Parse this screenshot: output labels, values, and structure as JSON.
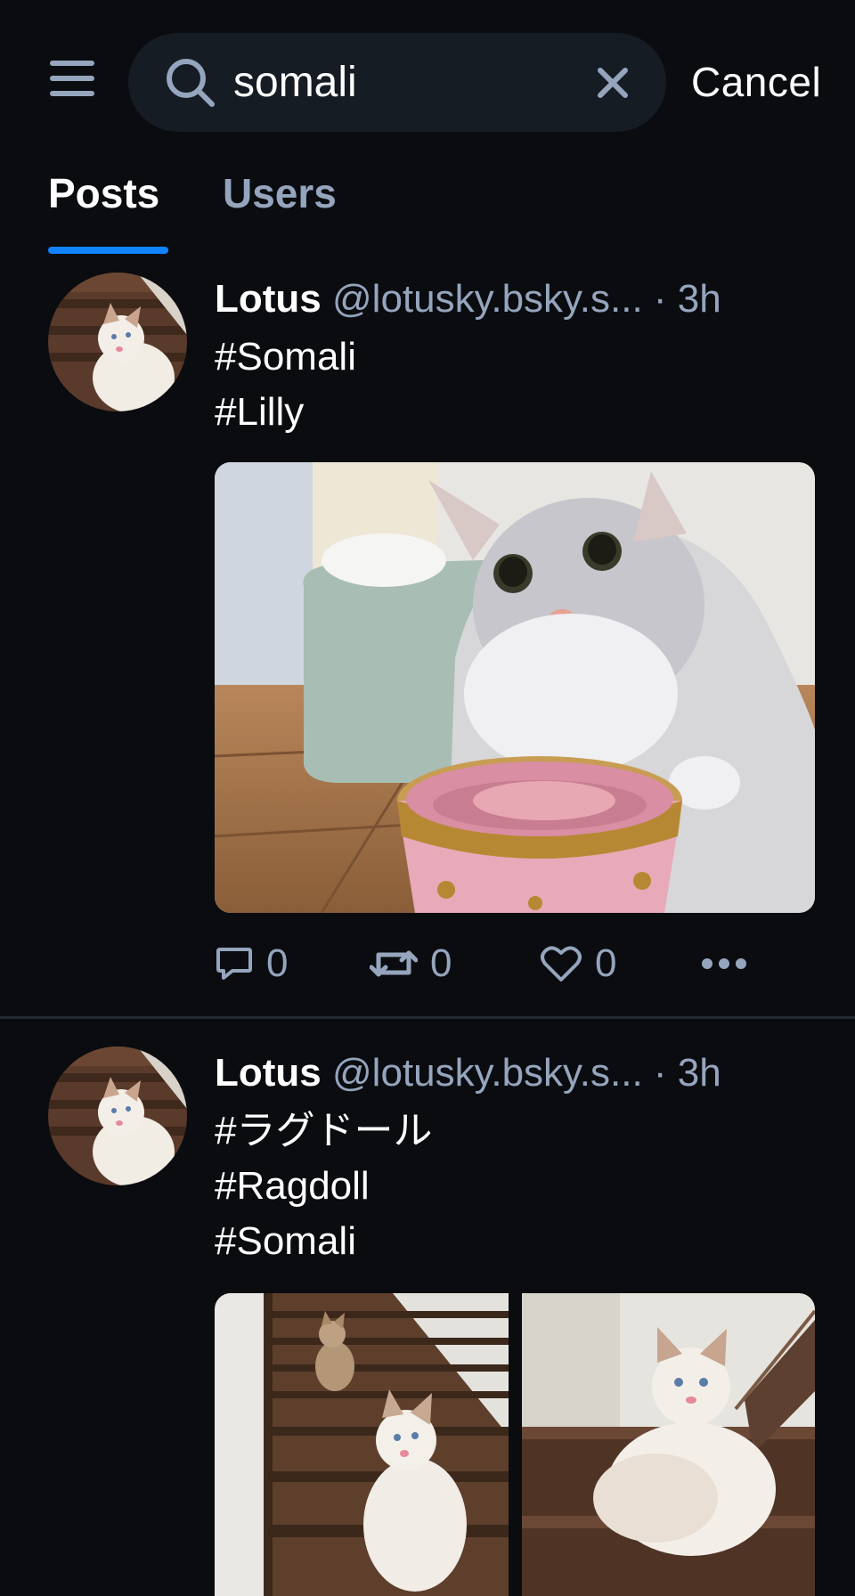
{
  "header": {
    "search_value": "somali",
    "cancel_label": "Cancel"
  },
  "tabs": [
    {
      "label": "Posts",
      "active": true
    },
    {
      "label": "Users",
      "active": false
    }
  ],
  "colors": {
    "background": "#0a0c10",
    "accent": "#1083fe",
    "muted": "#95a5bd",
    "search_bg": "#161c24",
    "divider": "#222b36"
  },
  "posts": [
    {
      "author": "Lotus",
      "handle": "@lotusky.bsky.s...",
      "time": "· 3h",
      "lines": [
        "#Somali",
        "#Lilly"
      ],
      "images": 1,
      "replies": "0",
      "reposts": "0",
      "likes": "0"
    },
    {
      "author": "Lotus",
      "handle": "@lotusky.bsky.s...",
      "time": "· 3h",
      "lines": [
        "#ラグドール",
        "#Ragdoll",
        "#Somali"
      ],
      "images": 2
    }
  ],
  "icons": {
    "menu": "hamburger-menu-icon",
    "search": "search-icon",
    "clear": "close-icon",
    "reply": "reply-bubble-icon",
    "repost": "repost-icon",
    "like": "heart-icon",
    "more": "more-dots-icon"
  }
}
